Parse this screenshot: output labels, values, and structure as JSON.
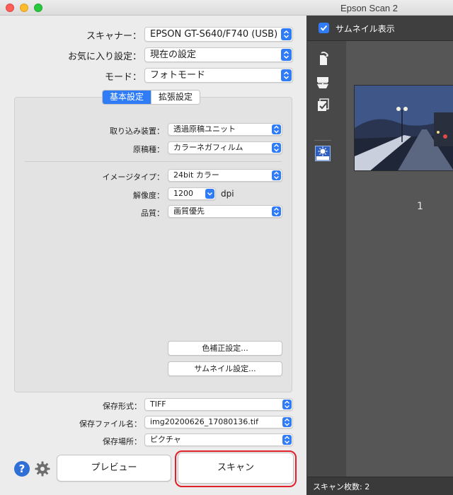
{
  "window": {
    "title": "Epson Scan 2"
  },
  "main": {
    "scanner": {
      "label": "スキャナー：",
      "value": "EPSON GT-S640/F740 (USB)"
    },
    "favorite": {
      "label": "お気に入り設定：",
      "value": "現在の設定"
    },
    "mode": {
      "label": "モード：",
      "value": "フォトモード"
    }
  },
  "tabs": {
    "basic": "基本設定",
    "advanced": "拡張設定"
  },
  "basic_settings": {
    "source": {
      "label": "取り込み装置：",
      "value": "透過原稿ユニット"
    },
    "document_type": {
      "label": "原稿種：",
      "value": "カラーネガフィルム"
    },
    "image_type": {
      "label": "イメージタイプ：",
      "value": "24bit カラー"
    },
    "resolution": {
      "label": "解像度：",
      "value": "1200",
      "unit": "dpi"
    },
    "quality": {
      "label": "品質：",
      "value": "画質優先"
    },
    "color_correction_button": "色補正設定...",
    "thumbnail_settings_button": "サムネイル設定..."
  },
  "save": {
    "format": {
      "label": "保存形式：",
      "value": "TIFF"
    },
    "filename": {
      "label": "保存ファイル名：",
      "value": "img20200626_17080136.tif"
    },
    "location": {
      "label": "保存場所：",
      "value": "ピクチャ"
    }
  },
  "buttons": {
    "preview": "プレビュー",
    "scan": "スキャン",
    "help": "?"
  },
  "thumbnail_pane": {
    "show_thumbnail_label": "サムネイル表示",
    "show_thumbnail_checked": true,
    "thumbnail_number": "1",
    "scan_count": "スキャン枚数: 2"
  },
  "colors": {
    "accent": "#2f7cf6",
    "highlight": "#e0202a"
  }
}
